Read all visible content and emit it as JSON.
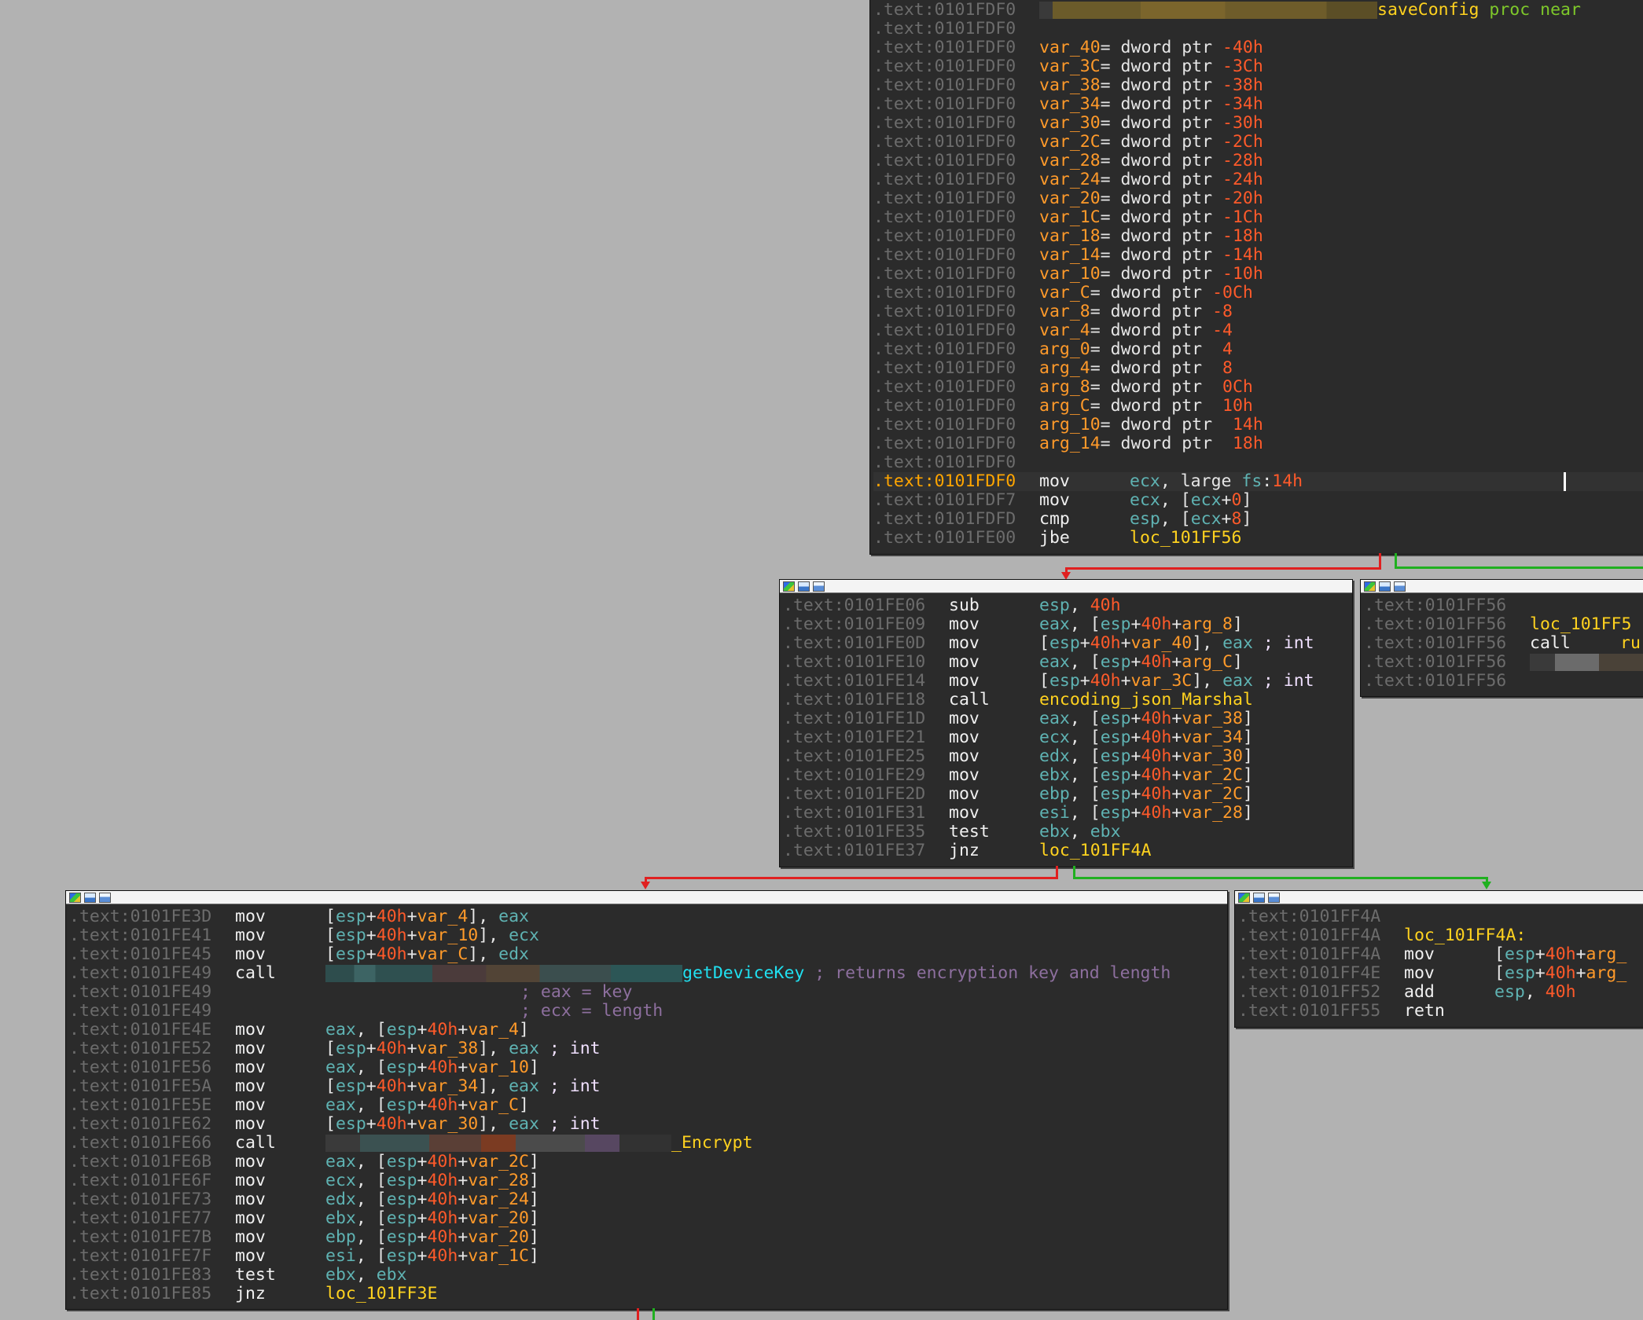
{
  "node1": {
    "header": {
      "addr": ".text:0101FDF0",
      "proc_name": "saveConfig",
      "proc_kw": "proc near"
    },
    "blank1": ".text:0101FDF0",
    "vars": [
      {
        "addr": ".text:0101FDF0",
        "name": "var_40",
        "eq": "= dword ptr ",
        "off": "-40h"
      },
      {
        "addr": ".text:0101FDF0",
        "name": "var_3C",
        "eq": "= dword ptr ",
        "off": "-3Ch"
      },
      {
        "addr": ".text:0101FDF0",
        "name": "var_38",
        "eq": "= dword ptr ",
        "off": "-38h"
      },
      {
        "addr": ".text:0101FDF0",
        "name": "var_34",
        "eq": "= dword ptr ",
        "off": "-34h"
      },
      {
        "addr": ".text:0101FDF0",
        "name": "var_30",
        "eq": "= dword ptr ",
        "off": "-30h"
      },
      {
        "addr": ".text:0101FDF0",
        "name": "var_2C",
        "eq": "= dword ptr ",
        "off": "-2Ch"
      },
      {
        "addr": ".text:0101FDF0",
        "name": "var_28",
        "eq": "= dword ptr ",
        "off": "-28h"
      },
      {
        "addr": ".text:0101FDF0",
        "name": "var_24",
        "eq": "= dword ptr ",
        "off": "-24h"
      },
      {
        "addr": ".text:0101FDF0",
        "name": "var_20",
        "eq": "= dword ptr ",
        "off": "-20h"
      },
      {
        "addr": ".text:0101FDF0",
        "name": "var_1C",
        "eq": "= dword ptr ",
        "off": "-1Ch"
      },
      {
        "addr": ".text:0101FDF0",
        "name": "var_18",
        "eq": "= dword ptr ",
        "off": "-18h"
      },
      {
        "addr": ".text:0101FDF0",
        "name": "var_14",
        "eq": "= dword ptr ",
        "off": "-14h"
      },
      {
        "addr": ".text:0101FDF0",
        "name": "var_10",
        "eq": "= dword ptr ",
        "off": "-10h"
      },
      {
        "addr": ".text:0101FDF0",
        "name": "var_C",
        "eq": "= dword ptr ",
        "off": "-0Ch"
      },
      {
        "addr": ".text:0101FDF0",
        "name": "var_8",
        "eq": "= dword ptr ",
        "off": "-8"
      },
      {
        "addr": ".text:0101FDF0",
        "name": "var_4",
        "eq": "= dword ptr ",
        "off": "-4"
      },
      {
        "addr": ".text:0101FDF0",
        "name": "arg_0",
        "eq": "= dword ptr  ",
        "off": "4"
      },
      {
        "addr": ".text:0101FDF0",
        "name": "arg_4",
        "eq": "= dword ptr  ",
        "off": "8"
      },
      {
        "addr": ".text:0101FDF0",
        "name": "arg_8",
        "eq": "= dword ptr  ",
        "off": "0Ch"
      },
      {
        "addr": ".text:0101FDF0",
        "name": "arg_C",
        "eq": "= dword ptr  ",
        "off": "10h"
      },
      {
        "addr": ".text:0101FDF0",
        "name": "arg_10",
        "eq": "= dword ptr  ",
        "off": "14h"
      },
      {
        "addr": ".text:0101FDF0",
        "name": "arg_14",
        "eq": "= dword ptr  ",
        "off": "18h"
      }
    ],
    "blank2": ".text:0101FDF0",
    "insn1": {
      "addr": ".text:0101FDF0",
      "mn": "mov",
      "a": "ecx",
      "b": ", large ",
      "c": "fs",
      "d": ":",
      "e": "14h"
    },
    "insn2": {
      "addr": ".text:0101FDF7",
      "mn": "mov",
      "a": "ecx",
      "b": ", [",
      "c": "ecx",
      "d": "+",
      "e": "0",
      "f": "]"
    },
    "insn3": {
      "addr": ".text:0101FDFD",
      "mn": "cmp",
      "a": "esp",
      "b": ", [",
      "c": "ecx",
      "d": "+",
      "e": "8",
      "f": "]"
    },
    "insn4": {
      "addr": ".text:0101FE00",
      "mn": "jbe",
      "a": "loc_101FF56"
    }
  },
  "node2": {
    "l1": {
      "addr": ".text:0101FE06",
      "mn": "sub",
      "a": "esp",
      "b": ", ",
      "c": "40h"
    },
    "mem": [
      {
        "addr": ".text:0101FE09",
        "mn": "mov",
        "reg": "eax",
        "var": "arg_8"
      },
      {
        "addr": ".text:0101FE10",
        "mn": "mov",
        "reg": "eax",
        "var": "arg_C"
      }
    ],
    "st1": {
      "addr": ".text:0101FE0D",
      "mn": "mov",
      "var": "var_40",
      "reg": "eax",
      "cmt": "; int"
    },
    "st2": {
      "addr": ".text:0101FE14",
      "mn": "mov",
      "var": "var_3C",
      "reg": "eax",
      "cmt": "; int"
    },
    "call": {
      "addr": ".text:0101FE18",
      "mn": "call",
      "fn": "encoding_json_Marshal"
    },
    "loads": [
      {
        "addr": ".text:0101FE1D",
        "mn": "mov",
        "reg": "eax",
        "var": "var_38"
      },
      {
        "addr": ".text:0101FE21",
        "mn": "mov",
        "reg": "ecx",
        "var": "var_34"
      },
      {
        "addr": ".text:0101FE25",
        "mn": "mov",
        "reg": "edx",
        "var": "var_30"
      },
      {
        "addr": ".text:0101FE29",
        "mn": "mov",
        "reg": "ebx",
        "var": "var_2C"
      },
      {
        "addr": ".text:0101FE2D",
        "mn": "mov",
        "reg": "ebp",
        "var": "var_2C"
      },
      {
        "addr": ".text:0101FE31",
        "mn": "mov",
        "reg": "esi",
        "var": "var_28"
      }
    ],
    "test": {
      "addr": ".text:0101FE35",
      "mn": "test",
      "a": "ebx",
      "b": ", ",
      "c": "ebx"
    },
    "jnz": {
      "addr": ".text:0101FE37",
      "mn": "jnz",
      "a": "loc_101FF4A"
    }
  },
  "node3": {
    "l1": {
      "addr": ".text:0101FF56"
    },
    "l2": {
      "addr": ".text:0101FF56",
      "lbl": "loc_101FF5"
    },
    "l3": {
      "addr": ".text:0101FF56",
      "mn": "call",
      "a": "ru"
    },
    "l4": {
      "addr": ".text:0101FF56"
    },
    "l5": {
      "addr": ".text:0101FF56"
    }
  },
  "node4": {
    "stores": [
      {
        "addr": ".text:0101FE3D",
        "mn": "mov",
        "var": "var_4",
        "reg": "eax"
      },
      {
        "addr": ".text:0101FE41",
        "mn": "mov",
        "var": "var_10",
        "reg": "ecx"
      },
      {
        "addr": ".text:0101FE45",
        "mn": "mov",
        "var": "var_C",
        "reg": "edx"
      }
    ],
    "call1": {
      "addr": ".text:0101FE49",
      "mn": "call",
      "fn": "getDeviceKey",
      "cmt": "; returns encryption key and length"
    },
    "c2": {
      "addr": ".text:0101FE49",
      "cmt": "; eax = key"
    },
    "c3": {
      "addr": ".text:0101FE49",
      "cmt": "; ecx = length"
    },
    "mid": [
      {
        "addr": ".text:0101FE4E",
        "kind": "load",
        "mn": "mov",
        "reg": "eax",
        "var": "var_4"
      },
      {
        "addr": ".text:0101FE52",
        "kind": "store",
        "mn": "mov",
        "reg": "eax",
        "var": "var_38",
        "cmt": "; int"
      },
      {
        "addr": ".text:0101FE56",
        "kind": "load",
        "mn": "mov",
        "reg": "eax",
        "var": "var_10"
      },
      {
        "addr": ".text:0101FE5A",
        "kind": "store",
        "mn": "mov",
        "reg": "eax",
        "var": "var_34",
        "cmt": "; int"
      },
      {
        "addr": ".text:0101FE5E",
        "kind": "load",
        "mn": "mov",
        "reg": "eax",
        "var": "var_C"
      },
      {
        "addr": ".text:0101FE62",
        "kind": "store",
        "mn": "mov",
        "reg": "eax",
        "var": "var_30",
        "cmt": "; int"
      }
    ],
    "call2": {
      "addr": ".text:0101FE66",
      "mn": "call",
      "fn": "_Encrypt"
    },
    "loads": [
      {
        "addr": ".text:0101FE6B",
        "mn": "mov",
        "reg": "eax",
        "var": "var_2C"
      },
      {
        "addr": ".text:0101FE6F",
        "mn": "mov",
        "reg": "ecx",
        "var": "var_28"
      },
      {
        "addr": ".text:0101FE73",
        "mn": "mov",
        "reg": "edx",
        "var": "var_24"
      },
      {
        "addr": ".text:0101FE77",
        "mn": "mov",
        "reg": "ebx",
        "var": "var_20"
      },
      {
        "addr": ".text:0101FE7B",
        "mn": "mov",
        "reg": "ebp",
        "var": "var_20"
      },
      {
        "addr": ".text:0101FE7F",
        "mn": "mov",
        "reg": "esi",
        "var": "var_1C"
      }
    ],
    "test": {
      "addr": ".text:0101FE83",
      "mn": "test",
      "a": "ebx",
      "b": ", ",
      "c": "ebx"
    },
    "jnz": {
      "addr": ".text:0101FE85",
      "mn": "jnz",
      "a": "loc_101FF3E"
    }
  },
  "node5": {
    "l1": {
      "addr": ".text:0101FF4A"
    },
    "l2": {
      "addr": ".text:0101FF4A",
      "lbl": "loc_101FF4A:"
    },
    "l3": {
      "addr": ".text:0101FF4A",
      "mn": "mov",
      "open": "[",
      "r": "esp",
      "p": "+",
      "n": "40h",
      "p2": "+",
      "v": "arg_"
    },
    "l4": {
      "addr": ".text:0101FF4E",
      "mn": "mov",
      "open": "[",
      "r": "esp",
      "p": "+",
      "n": "40h",
      "p2": "+",
      "v": "arg_"
    },
    "l5": {
      "addr": ".text:0101FF52",
      "mn": "add",
      "a": "esp",
      "b": ", ",
      "c": "40h"
    },
    "l6": {
      "addr": ".text:0101FF55",
      "mn": "retn"
    }
  },
  "common": {
    "lb": "[",
    "rb": "]",
    "plus": "+",
    "c40": "40h",
    "comma_sp": ", ",
    "comma_br": ", [",
    "rb_comma": "], "
  },
  "colors": {
    "background": "#b2b2b2",
    "node_bg": "#2b2b2b",
    "address": "#6c6c6c",
    "register": "#5fb3b3",
    "number": "#ff5a2a",
    "variable": "#ff9a2a",
    "label": "#ffd21f",
    "function": "#20e0f0",
    "comment": "#8d6f9e",
    "edge_false": "#e02020",
    "edge_true": "#20b020"
  }
}
